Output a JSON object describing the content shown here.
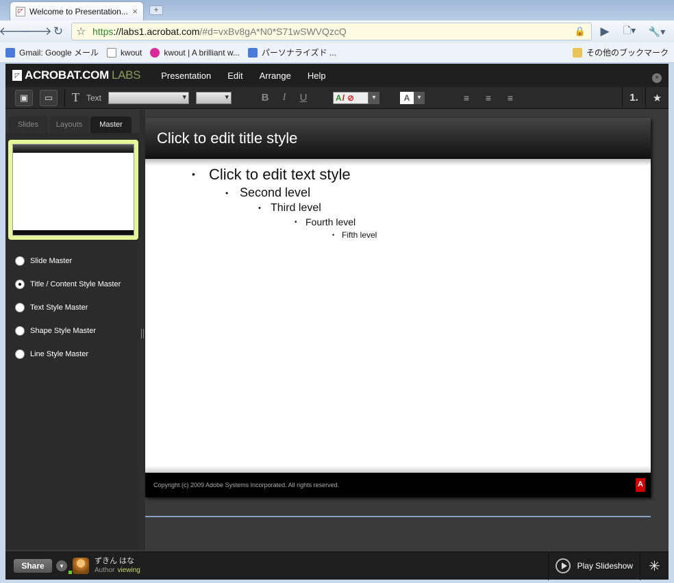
{
  "browser": {
    "tab_title": "Welcome to Presentation...",
    "tab_close": "×",
    "new_tab": "+",
    "url_scheme": "https",
    "url_host": "://labs1.acrobat.com",
    "url_rest": "/#d=vxBv8gA*N0*S71wSWVQzcQ",
    "back": "🡐",
    "forward": "🡒",
    "reload": "↻",
    "star": "☆",
    "lock": "🔒",
    "go": "▶",
    "page_menu": "🗋▾",
    "wrench": "🔧▾",
    "bookmarks": [
      {
        "label": "Gmail: Google メール",
        "icon_color": "#4a7bd9"
      },
      {
        "label": "kwout",
        "icon_color": "#ffffff"
      },
      {
        "label": "kwout | A brilliant w...",
        "icon_color": "#d8299a"
      },
      {
        "label": "パーソナライズド ...",
        "icon_color": "#4a7bd9"
      }
    ],
    "other_bookmarks": "その他のブックマーク"
  },
  "app": {
    "logo_main": "ACROBAT.COM",
    "logo_labs": "LABS",
    "menu": [
      "Presentation",
      "Edit",
      "Arrange",
      "Help"
    ],
    "close": "×",
    "format": {
      "text_label": "Text",
      "bold": "B",
      "italic": "I",
      "underline": "U",
      "color_a": "A",
      "fill_a": "A",
      "number": "1."
    },
    "left_tabs": [
      "Slides",
      "Layouts",
      "Master"
    ],
    "master_options": [
      {
        "label": "Slide Master",
        "selected": false
      },
      {
        "label": "Title / Content Style Master",
        "selected": true
      },
      {
        "label": "Text Style Master",
        "selected": false
      },
      {
        "label": "Shape Style Master",
        "selected": false
      },
      {
        "label": "Line Style Master",
        "selected": false
      }
    ],
    "slide": {
      "title": "Click to edit title style",
      "levels": [
        "Click to edit text style",
        "Second level",
        "Third level",
        "Fourth level",
        "Fifth level"
      ],
      "footer": "Copyright (c) 2009 Adobe Systems Incorporated. All rights reserved.",
      "adobe_mark": "A"
    },
    "status": {
      "share": "Share",
      "user_name": "ずきん はな",
      "role": "Author",
      "viewing": "viewing",
      "play": "Play Slideshow"
    }
  }
}
